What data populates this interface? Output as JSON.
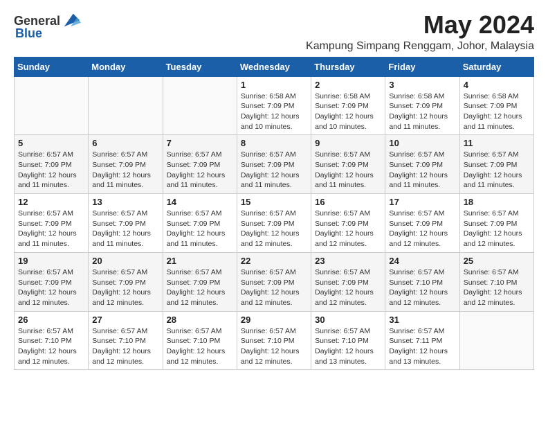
{
  "header": {
    "logo_general": "General",
    "logo_blue": "Blue",
    "month_title": "May 2024",
    "location": "Kampung Simpang Renggam, Johor, Malaysia"
  },
  "days_of_week": [
    "Sunday",
    "Monday",
    "Tuesday",
    "Wednesday",
    "Thursday",
    "Friday",
    "Saturday"
  ],
  "weeks": [
    [
      {
        "day": "",
        "info": ""
      },
      {
        "day": "",
        "info": ""
      },
      {
        "day": "",
        "info": ""
      },
      {
        "day": "1",
        "info": "Sunrise: 6:58 AM\nSunset: 7:09 PM\nDaylight: 12 hours and 10 minutes."
      },
      {
        "day": "2",
        "info": "Sunrise: 6:58 AM\nSunset: 7:09 PM\nDaylight: 12 hours and 10 minutes."
      },
      {
        "day": "3",
        "info": "Sunrise: 6:58 AM\nSunset: 7:09 PM\nDaylight: 12 hours and 11 minutes."
      },
      {
        "day": "4",
        "info": "Sunrise: 6:58 AM\nSunset: 7:09 PM\nDaylight: 12 hours and 11 minutes."
      }
    ],
    [
      {
        "day": "5",
        "info": "Sunrise: 6:57 AM\nSunset: 7:09 PM\nDaylight: 12 hours and 11 minutes."
      },
      {
        "day": "6",
        "info": "Sunrise: 6:57 AM\nSunset: 7:09 PM\nDaylight: 12 hours and 11 minutes."
      },
      {
        "day": "7",
        "info": "Sunrise: 6:57 AM\nSunset: 7:09 PM\nDaylight: 12 hours and 11 minutes."
      },
      {
        "day": "8",
        "info": "Sunrise: 6:57 AM\nSunset: 7:09 PM\nDaylight: 12 hours and 11 minutes."
      },
      {
        "day": "9",
        "info": "Sunrise: 6:57 AM\nSunset: 7:09 PM\nDaylight: 12 hours and 11 minutes."
      },
      {
        "day": "10",
        "info": "Sunrise: 6:57 AM\nSunset: 7:09 PM\nDaylight: 12 hours and 11 minutes."
      },
      {
        "day": "11",
        "info": "Sunrise: 6:57 AM\nSunset: 7:09 PM\nDaylight: 12 hours and 11 minutes."
      }
    ],
    [
      {
        "day": "12",
        "info": "Sunrise: 6:57 AM\nSunset: 7:09 PM\nDaylight: 12 hours and 11 minutes."
      },
      {
        "day": "13",
        "info": "Sunrise: 6:57 AM\nSunset: 7:09 PM\nDaylight: 12 hours and 11 minutes."
      },
      {
        "day": "14",
        "info": "Sunrise: 6:57 AM\nSunset: 7:09 PM\nDaylight: 12 hours and 11 minutes."
      },
      {
        "day": "15",
        "info": "Sunrise: 6:57 AM\nSunset: 7:09 PM\nDaylight: 12 hours and 12 minutes."
      },
      {
        "day": "16",
        "info": "Sunrise: 6:57 AM\nSunset: 7:09 PM\nDaylight: 12 hours and 12 minutes."
      },
      {
        "day": "17",
        "info": "Sunrise: 6:57 AM\nSunset: 7:09 PM\nDaylight: 12 hours and 12 minutes."
      },
      {
        "day": "18",
        "info": "Sunrise: 6:57 AM\nSunset: 7:09 PM\nDaylight: 12 hours and 12 minutes."
      }
    ],
    [
      {
        "day": "19",
        "info": "Sunrise: 6:57 AM\nSunset: 7:09 PM\nDaylight: 12 hours and 12 minutes."
      },
      {
        "day": "20",
        "info": "Sunrise: 6:57 AM\nSunset: 7:09 PM\nDaylight: 12 hours and 12 minutes."
      },
      {
        "day": "21",
        "info": "Sunrise: 6:57 AM\nSunset: 7:09 PM\nDaylight: 12 hours and 12 minutes."
      },
      {
        "day": "22",
        "info": "Sunrise: 6:57 AM\nSunset: 7:09 PM\nDaylight: 12 hours and 12 minutes."
      },
      {
        "day": "23",
        "info": "Sunrise: 6:57 AM\nSunset: 7:09 PM\nDaylight: 12 hours and 12 minutes."
      },
      {
        "day": "24",
        "info": "Sunrise: 6:57 AM\nSunset: 7:10 PM\nDaylight: 12 hours and 12 minutes."
      },
      {
        "day": "25",
        "info": "Sunrise: 6:57 AM\nSunset: 7:10 PM\nDaylight: 12 hours and 12 minutes."
      }
    ],
    [
      {
        "day": "26",
        "info": "Sunrise: 6:57 AM\nSunset: 7:10 PM\nDaylight: 12 hours and 12 minutes."
      },
      {
        "day": "27",
        "info": "Sunrise: 6:57 AM\nSunset: 7:10 PM\nDaylight: 12 hours and 12 minutes."
      },
      {
        "day": "28",
        "info": "Sunrise: 6:57 AM\nSunset: 7:10 PM\nDaylight: 12 hours and 12 minutes."
      },
      {
        "day": "29",
        "info": "Sunrise: 6:57 AM\nSunset: 7:10 PM\nDaylight: 12 hours and 12 minutes."
      },
      {
        "day": "30",
        "info": "Sunrise: 6:57 AM\nSunset: 7:10 PM\nDaylight: 12 hours and 13 minutes."
      },
      {
        "day": "31",
        "info": "Sunrise: 6:57 AM\nSunset: 7:11 PM\nDaylight: 12 hours and 13 minutes."
      },
      {
        "day": "",
        "info": ""
      }
    ]
  ]
}
